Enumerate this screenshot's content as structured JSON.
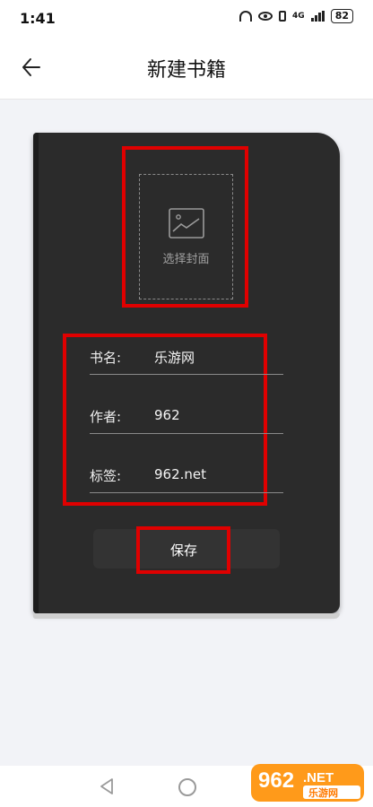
{
  "status_bar": {
    "time": "1:41",
    "network": "4G",
    "battery": "82"
  },
  "header": {
    "title": "新建书籍"
  },
  "cover": {
    "label": "选择封面"
  },
  "fields": [
    {
      "label": "书名:",
      "value": "乐游网"
    },
    {
      "label": "作者:",
      "value": "962"
    },
    {
      "label": "标签:",
      "value": "962.net"
    }
  ],
  "save_label": "保存",
  "watermark": {
    "brand": "962",
    "suffix": ".NET",
    "sub": "乐游网"
  },
  "colors": {
    "highlight_box": "#e00000",
    "book": "#2b2b2b",
    "background": "#f2f3f7"
  }
}
